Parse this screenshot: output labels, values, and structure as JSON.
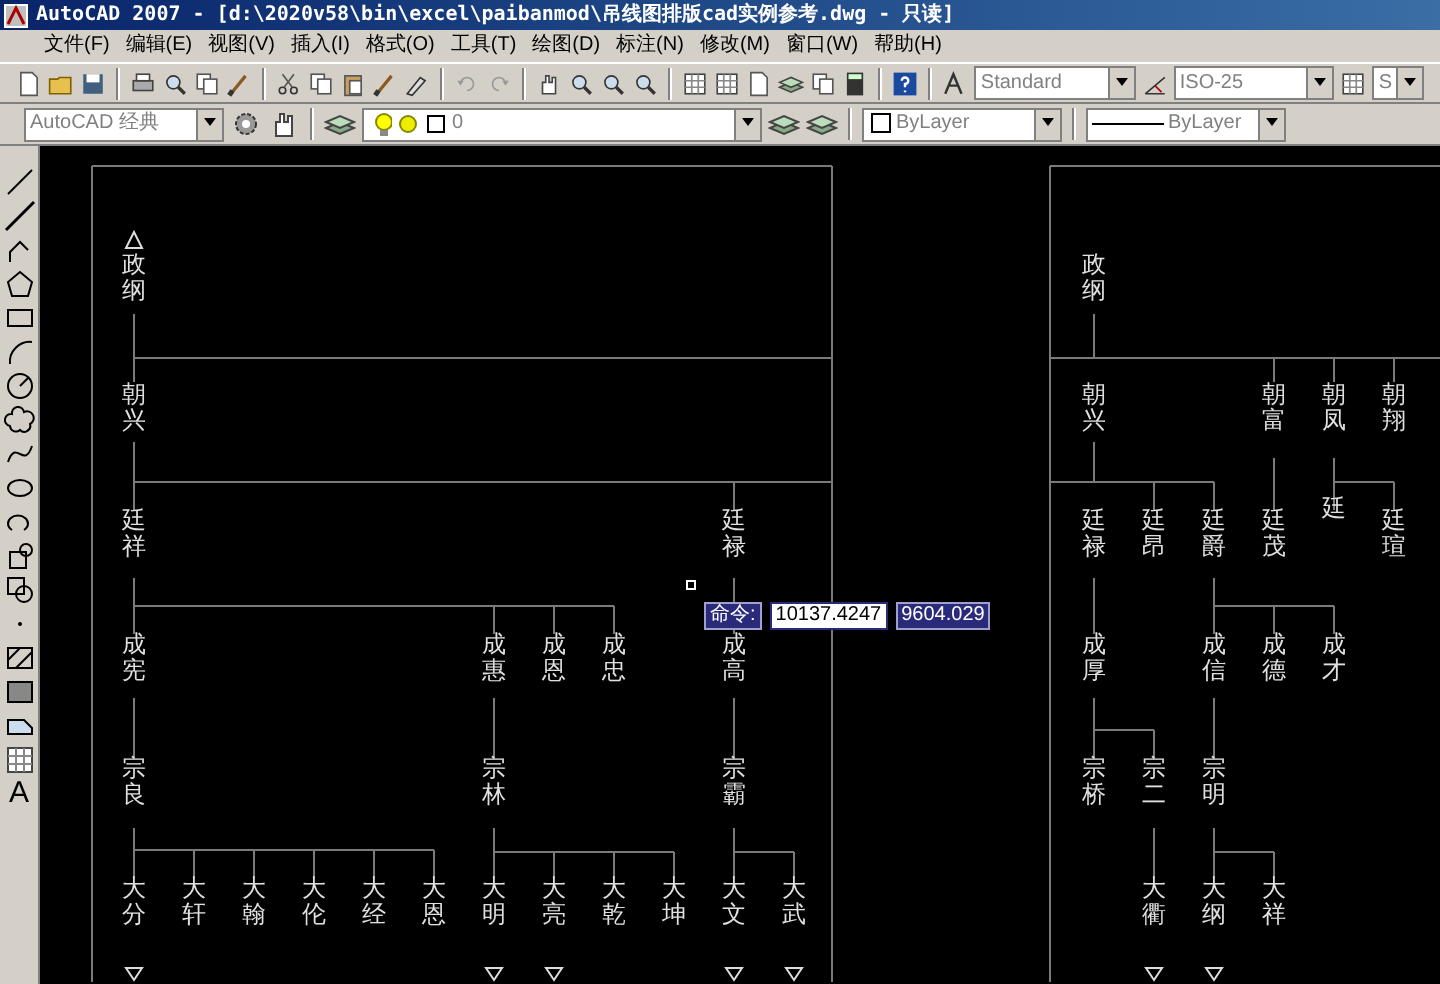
{
  "window": {
    "title": "AutoCAD 2007 - [d:\\2020v58\\bin\\excel\\paibanmod\\吊线图排版cad实例参考.dwg - 只读]"
  },
  "menu": [
    "文件(F)",
    "编辑(E)",
    "视图(V)",
    "插入(I)",
    "格式(O)",
    "工具(T)",
    "绘图(D)",
    "标注(N)",
    "修改(M)",
    "窗口(W)",
    "帮助(H)"
  ],
  "styles_toolbar": {
    "text_style": "Standard",
    "dimension_style": "ISO-25",
    "table_style": "S"
  },
  "workspace": "AutoCAD 经典",
  "layer": "0",
  "properties": {
    "color_control": "ByLayer",
    "linetype": "ByLayer"
  },
  "draw_toolbar": {
    "text_tool": "A"
  },
  "sheets": [
    {
      "nodes": [
        {
          "name": "政纲",
          "marker": false
        },
        {
          "name": "朝兴",
          "marker": false
        },
        {
          "name": "廷祥",
          "marker": false
        },
        {
          "name": "廷禄",
          "marker": false
        },
        {
          "name": "成宪",
          "marker": false
        },
        {
          "name": "成惠",
          "marker": false
        },
        {
          "name": "成恩",
          "marker": false
        },
        {
          "name": "成忠",
          "marker": false
        },
        {
          "name": "成高",
          "marker": false
        },
        {
          "name": "宗良",
          "marker": false
        },
        {
          "name": "宗林",
          "marker": false
        },
        {
          "name": "宗霸",
          "marker": false
        },
        {
          "name": "大分",
          "marker": true
        },
        {
          "name": "大轩",
          "marker": false
        },
        {
          "name": "大翰",
          "marker": false
        },
        {
          "name": "大伦",
          "marker": false
        },
        {
          "name": "大经",
          "marker": false
        },
        {
          "name": "大恩",
          "marker": false
        },
        {
          "name": "大明",
          "marker": true
        },
        {
          "name": "大亮",
          "marker": true
        },
        {
          "name": "大乾",
          "marker": false
        },
        {
          "name": "大坤",
          "marker": false
        },
        {
          "name": "大文",
          "marker": true
        },
        {
          "name": "大武",
          "marker": true
        }
      ]
    },
    {
      "nodes": [
        {
          "name": "政纲",
          "marker": false
        },
        {
          "name": "朝兴",
          "marker": false
        },
        {
          "name": "朝富",
          "marker": false
        },
        {
          "name": "朝凤",
          "marker": false
        },
        {
          "name": "朝翔",
          "marker": false
        },
        {
          "name": "廷禄",
          "marker": false
        },
        {
          "name": "廷昂",
          "marker": false
        },
        {
          "name": "廷爵",
          "marker": false
        },
        {
          "name": "廷茂",
          "marker": false
        },
        {
          "name": "廷",
          "marker": false
        },
        {
          "name": "廷瑄",
          "marker": false
        },
        {
          "name": "成厚",
          "marker": false
        },
        {
          "name": "成信",
          "marker": false
        },
        {
          "name": "成德",
          "marker": false
        },
        {
          "name": "成才",
          "marker": false
        },
        {
          "name": "宗桥",
          "marker": false
        },
        {
          "name": "宗二",
          "marker": false
        },
        {
          "name": "宗明",
          "marker": false
        },
        {
          "name": "大衢",
          "marker": true
        },
        {
          "name": "大纲",
          "marker": true
        },
        {
          "name": "大祥",
          "marker": false
        }
      ]
    }
  ],
  "command_tooltip": {
    "label": "命令:",
    "x_value": "10137.4247",
    "y_value": "9604.029"
  }
}
